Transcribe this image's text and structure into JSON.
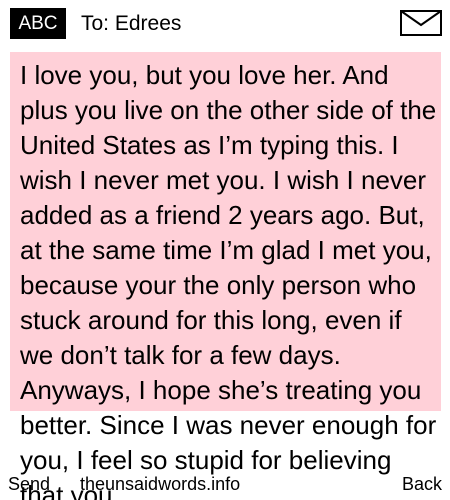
{
  "header": {
    "input_mode": "ABC",
    "recipient": "To: Edrees",
    "icon": "envelope-icon"
  },
  "message": {
    "body": "I love you, but you love her. And plus you live on the other side of the United States as I’m typing this. I wish I never met you. I wish I never added as a friend 2 years ago. But, at the same time I’m glad I met you, because your the only person who stuck around for this long, even if we don’t talk for a few days. Anyways, I hope she’s treating you better. Since I was never enough for you, I feel so stupid for believing that you"
  },
  "softkeys": {
    "left": "Send",
    "center": "theunsaidwords.info",
    "right": "Back"
  },
  "colors": {
    "panel": "#ffd0d8",
    "badge": "#000000"
  }
}
